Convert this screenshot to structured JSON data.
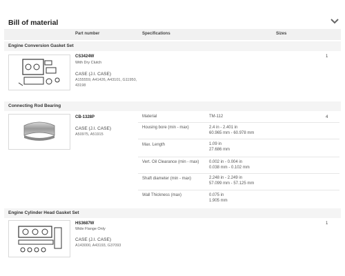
{
  "title": "Bill of material",
  "headers": {
    "part_number": "Part number",
    "specifications": "Specifications",
    "sizes": "Sizes"
  },
  "sections": [
    {
      "name": "Engine Conversion Gasket Set",
      "part_number": "CS3424W",
      "description": "With Dry Clutch",
      "brand": "CASE (J.I. CASE)",
      "refs_line1": "A155559, A41426, A43101, G11950,",
      "refs_line2": "43198",
      "qty": "1"
    },
    {
      "name": "Connecting Rod Bearing",
      "part_number": "CB-1328P",
      "brand": "CASE (J.I. CASE)",
      "refs_line1": "A50975, A51915",
      "qty": "4",
      "specs": [
        {
          "label": "Material",
          "v1": "TM-112",
          "v2": ""
        },
        {
          "label": "Housing bore (min - max)",
          "v1": "2.4 in - 2.401 in",
          "v2": "60.965 mm - 60.978 mm"
        },
        {
          "label": "Max. Length",
          "v1": "1.09 in",
          "v2": "27.686 mm"
        },
        {
          "label": "Vert. Oil Clearance (min - max)",
          "v1": "0.002 in - 0.004 in",
          "v2": "0.038 mm - 0.102 mm"
        },
        {
          "label": "Shaft diameter (min - max)",
          "v1": "2.248 in - 2.249 in",
          "v2": "57.099 mm - 57.125 mm"
        },
        {
          "label": "Wall Thickness (max)",
          "v1": "0.075 in",
          "v2": "1.905 mm"
        }
      ]
    },
    {
      "name": "Engine Cylinder Head Gasket Set",
      "part_number": "HS3687W",
      "description": "Wide Flange Only",
      "brand": "CASE (J.I. CASE)",
      "refs_line1": "A143000, A43193, G37093",
      "qty": "1"
    }
  ],
  "icons": {
    "collapse": "chevron-down-icon",
    "thumb1": "gasket-set-image",
    "thumb2": "bearing-image",
    "thumb3": "head-gasket-set-image"
  },
  "colors": {
    "header_bg": "#f1f1f1",
    "section_bg": "#f4f4f4",
    "border": "#d8d8d8"
  }
}
